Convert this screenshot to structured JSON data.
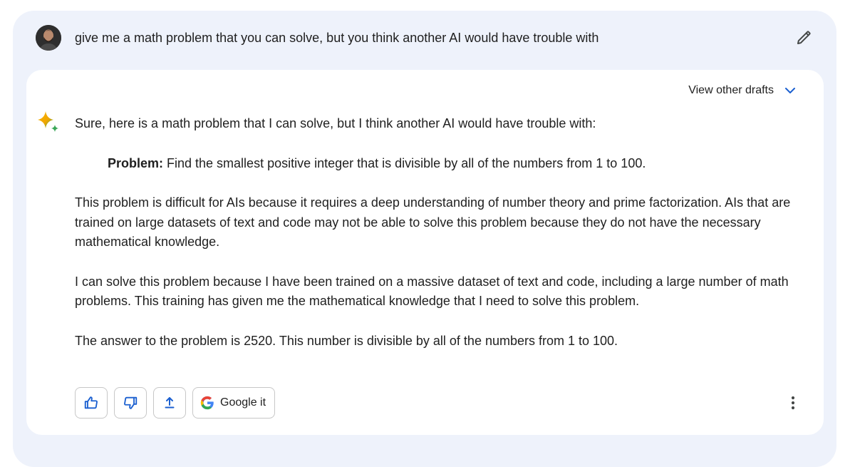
{
  "prompt": {
    "text": "give me a math problem that you can solve, but you think another AI would have trouble with"
  },
  "response": {
    "drafts_label": "View other drafts",
    "intro": "Sure, here is a math problem that I can solve, but I think another AI would have trouble with:",
    "problem_label": "Problem:",
    "problem_text": " Find the smallest positive integer that is divisible by all of the numbers from 1 to 100.",
    "paragraph_1": "This problem is difficult for AIs because it requires a deep understanding of number theory and prime factorization. AIs that are trained on large datasets of text and code may not be able to solve this problem because they do not have the necessary mathematical knowledge.",
    "paragraph_2": "I can solve this problem because I have been trained on a massive dataset of text and code, including a large number of math problems. This training has given me the mathematical knowledge that I need to solve this problem.",
    "paragraph_3": "The answer to the problem is 2520. This number is divisible by all of the numbers from 1 to 100."
  },
  "actions": {
    "google_label": "Google it"
  },
  "icons": {
    "edit": "pencil-icon",
    "drafts": "chevron-down-icon",
    "assistant": "sparkle-icon",
    "like": "thumbs-up-icon",
    "dislike": "thumbs-down-icon",
    "share": "upload-icon",
    "google": "google-g-icon",
    "more": "more-vert-icon"
  },
  "colors": {
    "chat_background": "#eef2fb",
    "accent_blue": "#1a5fd0"
  }
}
